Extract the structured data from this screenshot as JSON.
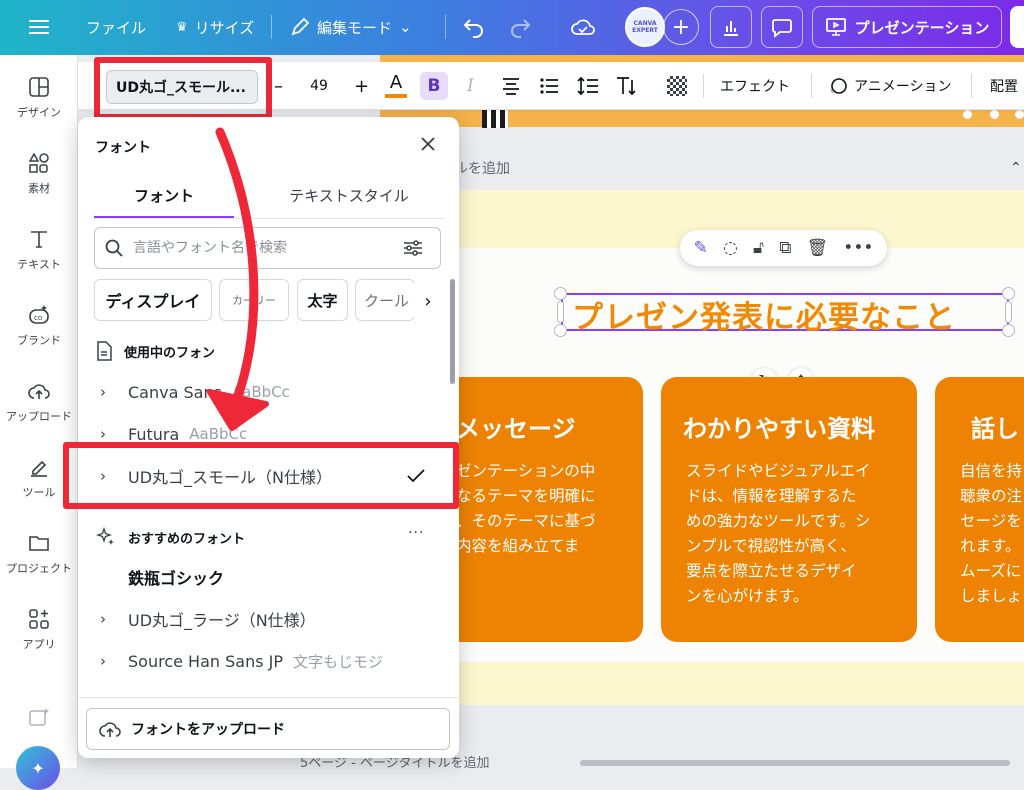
{
  "topbar": {
    "file_label": "ファイル",
    "resize_label": "リサイズ",
    "edit_mode_label": "編集モード",
    "avatar_text": "CANVA EXPERT",
    "present_label": "プレゼンテーション"
  },
  "sidebar": {
    "items": [
      {
        "label": "デザイン",
        "icon": "layout-icon"
      },
      {
        "label": "素材",
        "icon": "elements-icon"
      },
      {
        "label": "テキスト",
        "icon": "text-icon"
      },
      {
        "label": "ブランド",
        "icon": "brand-icon"
      },
      {
        "label": "アップロード",
        "icon": "cloud-upload-icon"
      },
      {
        "label": "ツール",
        "icon": "draw-icon"
      },
      {
        "label": "プロジェクト",
        "icon": "folder-icon"
      },
      {
        "label": "アプリ",
        "icon": "apps-icon"
      }
    ]
  },
  "toolbar": {
    "font_name": "UD丸ゴ_スモール...",
    "font_size": "49",
    "minus": "–",
    "plus": "+",
    "color_letter": "A",
    "bold": "B",
    "italic": "I",
    "effect_label": "エフェクト",
    "animation_label": "アニメーション",
    "position_label": "配置"
  },
  "font_panel": {
    "header": "フォント",
    "tabs": [
      "フォント",
      "テキストスタイル"
    ],
    "search_placeholder": "言語やフォント名で検索",
    "chips": [
      "ディスプレイ",
      "カーリー",
      "太字",
      "クール"
    ],
    "in_use_label": "使用中のフォン",
    "in_use_fonts": [
      {
        "name": "Canva Sans",
        "preview": "AaBbCc"
      },
      {
        "name": "Futura",
        "preview": "AaBbCc"
      },
      {
        "name": "UD丸ゴ_スモール（N仕様）",
        "preview": ""
      }
    ],
    "recommended_label": "おすすめのフォント",
    "recommended_fonts": [
      {
        "name": "鉄瓶ゴシック",
        "preview": ""
      },
      {
        "name": "UD丸ゴ_ラージ（N仕様）",
        "preview": ""
      },
      {
        "name": "Source Han Sans JP",
        "preview": "文字もじモジ"
      }
    ],
    "upload_label": "フォントをアップロード"
  },
  "canvas": {
    "add_page_title": "ルを追加",
    "slide_title": "プレゼン発表に必要なこと",
    "cards": [
      {
        "title": "メッセージ",
        "body": "ゼンテーションの中\nなるテーマを明確に\n、そのテーマに基づ\n内容を組み立てま"
      },
      {
        "title": "わかりやすい資料",
        "body": "スライドやビジュアルエイ\nドは、情報を理解するた\nめの強力なツールです。シ\nンプルで視認性が高く、\n要点を際立たせるデザイ\nンを心がけます。"
      },
      {
        "title": "話し",
        "body": "自信を持\n聴衆の注\nセージを\nれます。\nムーズに\nしましょ"
      }
    ],
    "bottom_page_label": "5ページ - ページタイトルを追加"
  }
}
